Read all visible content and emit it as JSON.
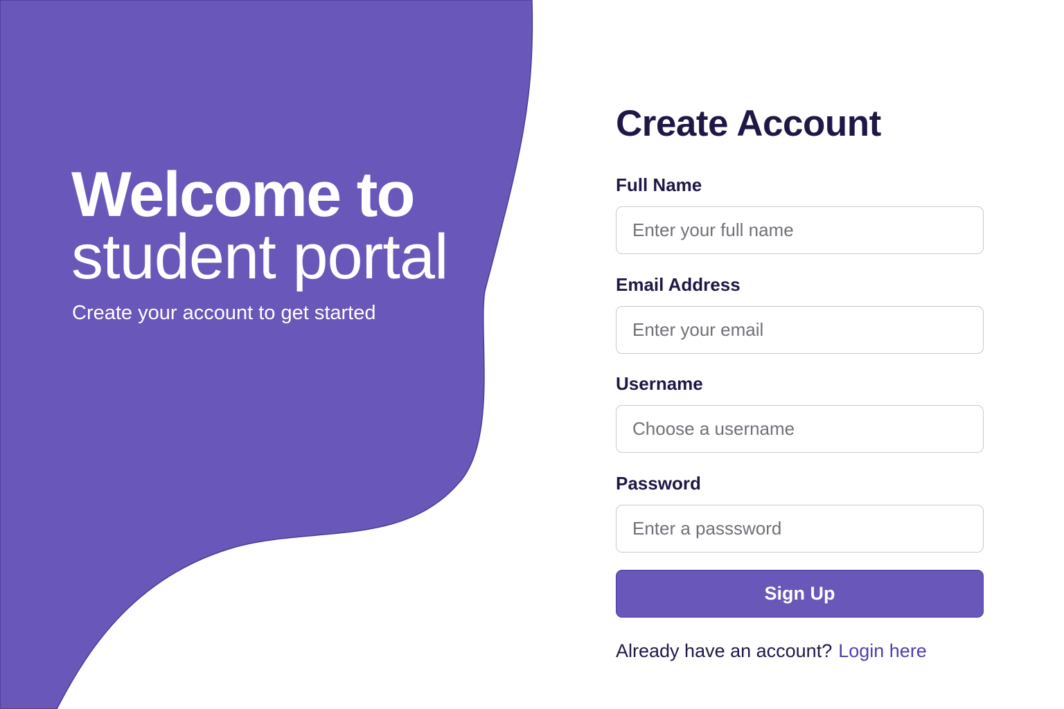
{
  "colors": {
    "accent": "#6957b9",
    "heading": "#1e1846",
    "link": "#4e3fad",
    "background": "#ffffff"
  },
  "hero": {
    "title_line1": "Welcome to",
    "title_line2": "student portal",
    "subtitle": "Create your account to get started"
  },
  "form": {
    "title": "Create Account",
    "fields": [
      {
        "label": "Full Name",
        "value": "",
        "placeholder": "Enter your full name"
      },
      {
        "label": "Email Address",
        "value": "",
        "placeholder": "Enter your email"
      },
      {
        "label": "Username",
        "value": "",
        "placeholder": "Choose a username"
      },
      {
        "label": "Password",
        "value": "",
        "placeholder": "Enter a passsword"
      }
    ],
    "submit_label": "Sign Up",
    "login_prompt": "Already have an account?",
    "login_link": "Login here"
  }
}
